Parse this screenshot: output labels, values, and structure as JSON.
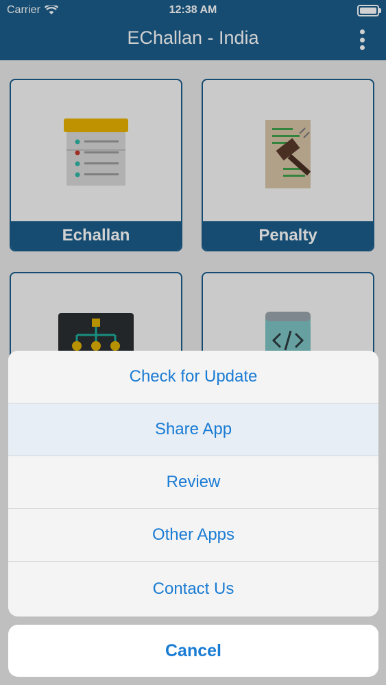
{
  "status_bar": {
    "carrier": "Carrier",
    "time": "12:38 AM"
  },
  "header": {
    "title": "EChallan - India"
  },
  "tiles": [
    {
      "label": "Echallan"
    },
    {
      "label": "Penalty"
    }
  ],
  "action_sheet": {
    "items": [
      {
        "label": "Check for Update"
      },
      {
        "label": "Share App"
      },
      {
        "label": "Review"
      },
      {
        "label": "Other Apps"
      },
      {
        "label": "Contact Us"
      }
    ],
    "cancel_label": "Cancel"
  },
  "colors": {
    "header_bg": "#1b5d8c",
    "action_text": "#1a7bd3"
  }
}
